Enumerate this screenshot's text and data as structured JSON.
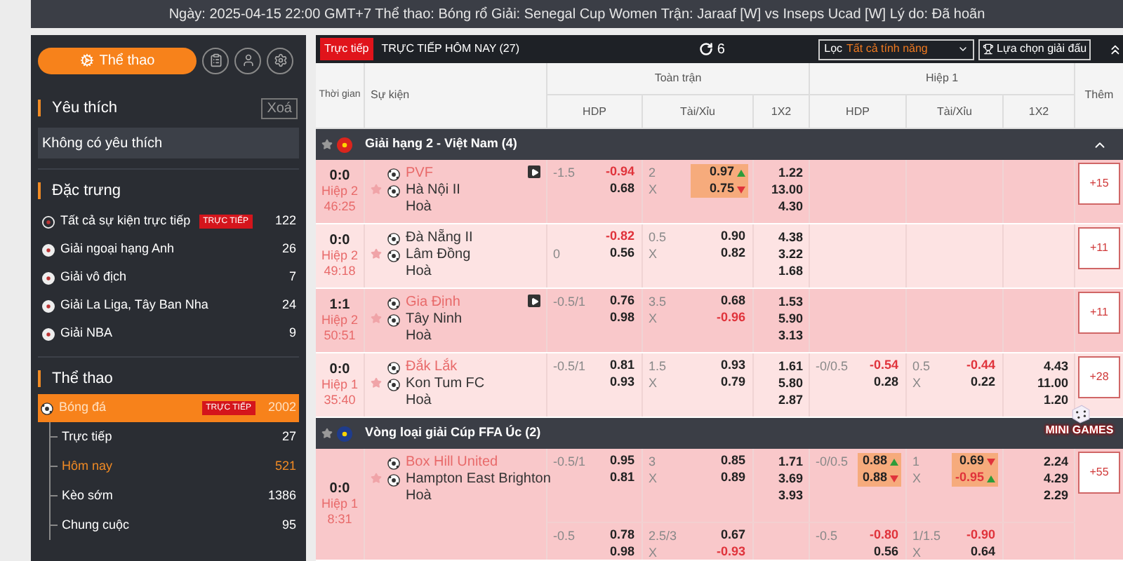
{
  "banner": "Ngày: 2025-04-15 22:00 GMT+7 Thể thao: Bóng rổ Giải: Senegal Cup Women Trận: Jaraaf [W] vs Inseps Ucad [W] Lý do: Đã hoãn",
  "sidebar": {
    "sport_button": "Thể thao",
    "favorites": {
      "title": "Yêu thích",
      "clear": "Xoá",
      "empty": "Không có yêu thích"
    },
    "featured": {
      "title": "Đặc trưng",
      "items": [
        {
          "label": "Tất cả sự kiện trực tiếp",
          "badge": "TRỰC TIẾP",
          "count": "122"
        },
        {
          "label": "Giải ngoại hạng Anh",
          "count": "26"
        },
        {
          "label": "Giải vô địch",
          "count": "7"
        },
        {
          "label": "Giải La Liga, Tây Ban Nha",
          "count": "24"
        },
        {
          "label": "Giải NBA",
          "count": "9"
        }
      ]
    },
    "sports": {
      "title": "Thể thao",
      "items": [
        {
          "label": "Bóng đá",
          "badge": "TRỰC TIẾP",
          "count": "2002",
          "selected": true,
          "expanded": true,
          "children": [
            {
              "label": "Trực tiếp",
              "count": "27",
              "selected": false
            },
            {
              "label": "Hôm nay",
              "count": "521",
              "selected": true
            },
            {
              "label": "Kèo sớm",
              "count": "1386",
              "selected": false
            },
            {
              "label": "Chung cuộc",
              "count": "95",
              "selected": false
            }
          ]
        }
      ]
    }
  },
  "toolbar": {
    "live_badge": "Trực tiếp",
    "title": "TRỰC TIẾP HÔM NAY (27)",
    "refresh_count": "6",
    "filter_label": "Lọc",
    "filter_value": "Tất cả tính năng",
    "tournament_button": "Lựa chọn giải đấu"
  },
  "columns": {
    "time": "Thời gian",
    "event": "Sự kiện",
    "full_time": "Toàn trận",
    "first_half": "Hiệp 1",
    "hdp": [
      "HDP",
      "HDP"
    ],
    "ou": [
      "Tài/Xỉu",
      "Tài/Xỉu"
    ],
    "x12": [
      "1X2",
      "1X2"
    ],
    "more": "Thêm"
  },
  "leagues": [
    {
      "name": "Giải hạng 2 - Việt Nam (4)",
      "color": "#da251d",
      "starred": false,
      "chevron": true,
      "matches": [
        {
          "score": "0:0",
          "period": "Hiệp 2",
          "clock": "46:25",
          "home": "PVF",
          "home_marked": true,
          "away": "Hà Nội II",
          "draw": "Hoà",
          "starred": false,
          "video": true,
          "more": "+15",
          "lines": [
            {
              "ft_hdp": {
                "line_home": "-1.5",
                "changed": false,
                "odds": [
                  {
                    "value": "-0.94",
                    "red": true
                  },
                  {
                    "value": "0.68",
                    "red": false
                  }
                ]
              },
              "ft_ou": {
                "line": "2",
                "x": "X",
                "changed": true,
                "odds": [
                  {
                    "value": "0.97",
                    "red": false,
                    "arrow": true,
                    "rising": true
                  },
                  {
                    "value": "0.75",
                    "red": false,
                    "arrow": true,
                    "rising": false
                  }
                ]
              },
              "ft_1x2": [
                "1.22",
                "13.00",
                "4.30"
              ]
            }
          ]
        },
        {
          "score": "0:0",
          "period": "Hiệp 2",
          "clock": "49:18",
          "home": "Đà Nẵng II",
          "home_marked": false,
          "away": "Lâm Đồng",
          "draw": "Hoà",
          "starred": false,
          "video": false,
          "more": "+11",
          "lines": [
            {
              "ft_hdp": {
                "line_away": "0",
                "changed": false,
                "odds": [
                  {
                    "value": "-0.82",
                    "red": true
                  },
                  {
                    "value": "0.56",
                    "red": false
                  }
                ]
              },
              "ft_ou": {
                "line": "0.5",
                "x": "X",
                "changed": false,
                "odds": [
                  {
                    "value": "0.90",
                    "red": false
                  },
                  {
                    "value": "0.82",
                    "red": false
                  }
                ]
              },
              "ft_1x2": [
                "4.38",
                "3.22",
                "1.68"
              ]
            }
          ]
        },
        {
          "score": "1:1",
          "period": "Hiệp 2",
          "clock": "50:51",
          "home": "Gia Định",
          "home_marked": true,
          "away": "Tây Ninh",
          "draw": "Hoà",
          "starred": false,
          "video": true,
          "more": "+11",
          "lines": [
            {
              "ft_hdp": {
                "line_home": "-0.5/1",
                "changed": false,
                "odds": [
                  {
                    "value": "0.76",
                    "red": false
                  },
                  {
                    "value": "0.98",
                    "red": false
                  }
                ]
              },
              "ft_ou": {
                "line": "3.5",
                "x": "X",
                "changed": false,
                "odds": [
                  {
                    "value": "0.68",
                    "red": false
                  },
                  {
                    "value": "-0.96",
                    "red": true
                  }
                ]
              },
              "ft_1x2": [
                "1.53",
                "5.90",
                "3.13"
              ]
            }
          ]
        },
        {
          "score": "0:0",
          "period": "Hiệp 1",
          "clock": "35:40",
          "home": "Đắk Lắk",
          "home_marked": true,
          "away": "Kon Tum FC",
          "draw": "Hoà",
          "starred": false,
          "video": false,
          "more": "+28",
          "lines": [
            {
              "ft_hdp": {
                "line_home": "-0.5/1",
                "changed": false,
                "odds": [
                  {
                    "value": "0.81",
                    "red": false
                  },
                  {
                    "value": "0.93",
                    "red": false
                  }
                ]
              },
              "ft_ou": {
                "line": "1.5",
                "x": "X",
                "changed": false,
                "odds": [
                  {
                    "value": "0.93",
                    "red": false
                  },
                  {
                    "value": "0.79",
                    "red": false
                  }
                ]
              },
              "ft_1x2": [
                "1.61",
                "5.80",
                "2.87"
              ],
              "h1_hdp": {
                "line_home": "-0/0.5",
                "changed": false,
                "odds": [
                  {
                    "value": "-0.54",
                    "red": true
                  },
                  {
                    "value": "0.28",
                    "red": false
                  }
                ]
              },
              "h1_ou": {
                "line": "0.5",
                "x": "X",
                "changed": false,
                "odds": [
                  {
                    "value": "-0.44",
                    "red": true
                  },
                  {
                    "value": "0.22",
                    "red": false
                  }
                ]
              },
              "h1_1x2": [
                "4.43",
                "11.00",
                "1.20"
              ]
            }
          ]
        }
      ]
    },
    {
      "name": "Vòng loại giải Cúp FFA Úc (2)",
      "color": "#1f3c8c",
      "starred": false,
      "chevron": false,
      "matches": [
        {
          "score": "0:0",
          "period": "Hiệp 1",
          "clock": "8:31",
          "home": "Box Hill United",
          "home_marked": true,
          "away": "Hampton East Brighton",
          "draw": "Hoà",
          "starred": false,
          "video": false,
          "more": "+55",
          "lines": [
            {
              "ft_hdp": {
                "line_home": "-0.5/1",
                "changed": false,
                "odds": [
                  {
                    "value": "0.95",
                    "red": false
                  },
                  {
                    "value": "0.81",
                    "red": false
                  }
                ]
              },
              "ft_ou": {
                "line": "3",
                "x": "X",
                "changed": false,
                "odds": [
                  {
                    "value": "0.85",
                    "red": false
                  },
                  {
                    "value": "0.89",
                    "red": false
                  }
                ]
              },
              "ft_1x2": [
                "1.71",
                "3.69",
                "3.93"
              ],
              "h1_hdp": {
                "line_home": "-0/0.5",
                "changed": true,
                "odds": [
                  {
                    "value": "0.88",
                    "red": false,
                    "arrow": true,
                    "rising": true
                  },
                  {
                    "value": "0.88",
                    "red": false,
                    "arrow": true,
                    "rising": false
                  }
                ]
              },
              "h1_ou": {
                "line": "1",
                "x": "X",
                "changed": true,
                "odds": [
                  {
                    "value": "0.69",
                    "red": false,
                    "arrow": true,
                    "rising": false
                  },
                  {
                    "value": "-0.95",
                    "red": true,
                    "arrow": true,
                    "rising": true
                  }
                ]
              },
              "h1_1x2": [
                "2.24",
                "4.29",
                "2.29"
              ]
            },
            {
              "ft_hdp": {
                "line_home": "-0.5",
                "changed": false,
                "odds": [
                  {
                    "value": "0.78",
                    "red": false
                  },
                  {
                    "value": "0.98",
                    "red": false
                  }
                ]
              },
              "ft_ou": {
                "line": "2.5/3",
                "x": "X",
                "changed": false,
                "odds": [
                  {
                    "value": "0.67",
                    "red": false
                  },
                  {
                    "value": "-0.93",
                    "red": true
                  }
                ]
              },
              "h1_hdp": {
                "line_home": "-0.5",
                "changed": false,
                "odds": [
                  {
                    "value": "-0.80",
                    "red": true
                  },
                  {
                    "value": "0.56",
                    "red": false
                  }
                ]
              },
              "h1_ou": {
                "line": "1/1.5",
                "x": "X",
                "changed": false,
                "odds": [
                  {
                    "value": "-0.90",
                    "red": true
                  },
                  {
                    "value": "0.64",
                    "red": false
                  }
                ]
              }
            }
          ]
        }
      ]
    }
  ],
  "mini_games": "MINI GAMES"
}
